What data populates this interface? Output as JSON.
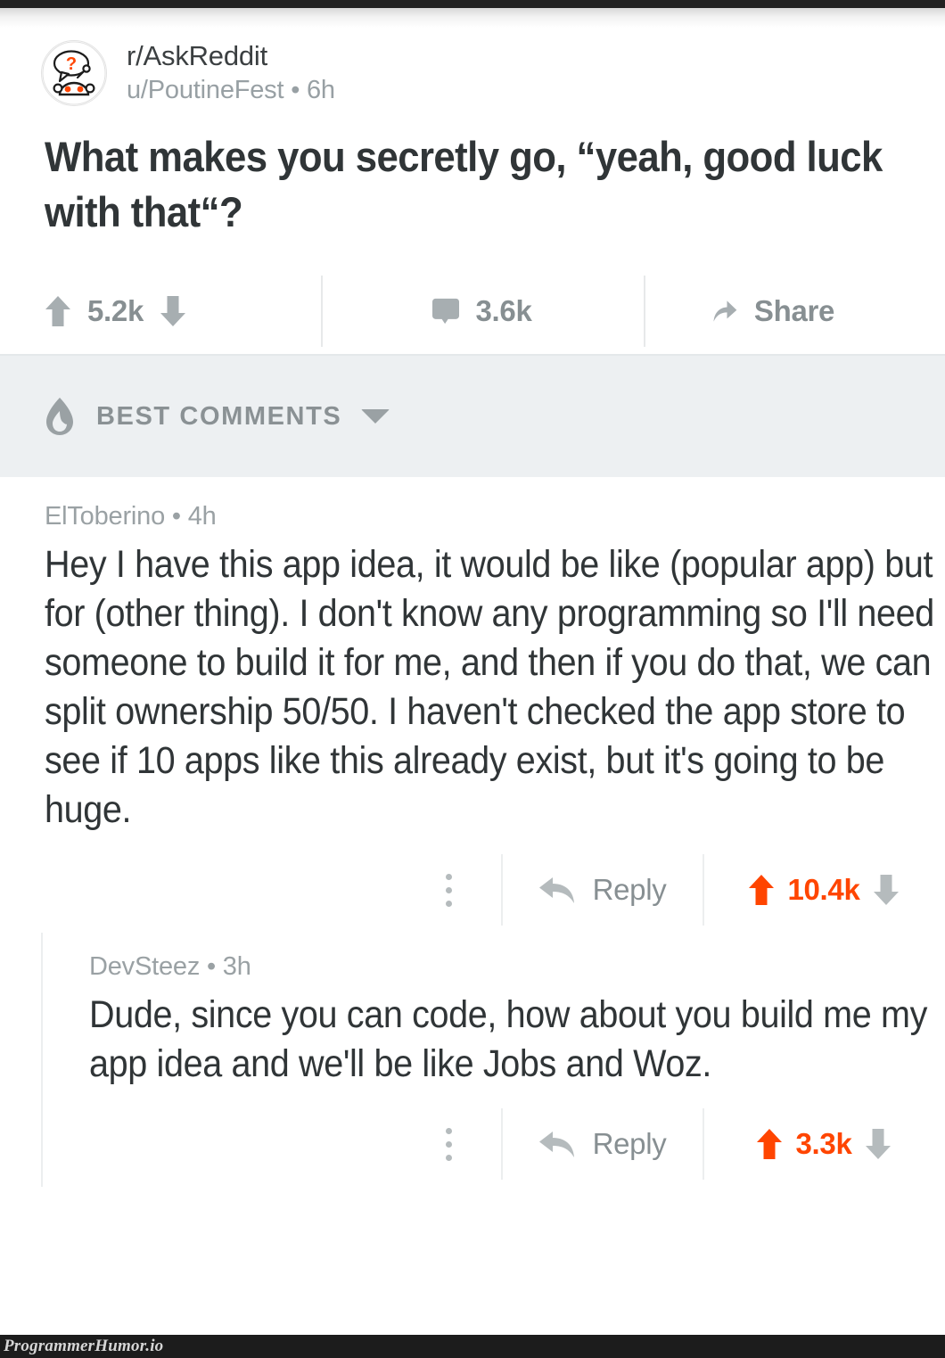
{
  "watermark": {
    "text": "ProgrammerHumor.io"
  },
  "post": {
    "subreddit": "r/AskReddit",
    "meta": "u/PoutineFest • 6h",
    "author": "u/PoutineFest",
    "age": "6h",
    "title": "What makes you secretly go, “yeah, good luck with that“?",
    "avatar_icon": "askreddit-snoo-question-avatar",
    "actions": {
      "upvote_icon": "upvote-arrow-icon",
      "downvote_icon": "downvote-arrow-icon",
      "score": "5.2k",
      "comment_icon": "comment-bubble-icon",
      "comment_count": "3.6k",
      "share_icon": "share-arrow-icon",
      "share_label": "Share"
    }
  },
  "sort_bar": {
    "icon": "flame-icon",
    "label": "BEST COMMENTS",
    "chevron_icon": "chevron-down-icon"
  },
  "comments": [
    {
      "author": "ElToberino",
      "age": "4h",
      "byline": "ElToberino • 4h",
      "body": "Hey I have this app idea, it would be like (popular app) but for (other thing). I don't know any programming so I'll need someone to build it for me, and then if you do that, we can split ownership 50/50. I haven't checked the app store to see if 10 apps like this already exist, but it's going to be huge.",
      "actions": {
        "kebab_icon": "more-options-icon",
        "reply_icon": "reply-arrow-icon",
        "reply_label": "Reply",
        "upvote_icon": "upvote-arrow-icon",
        "downvote_icon": "downvote-arrow-icon",
        "score": "10.4k",
        "score_color": "#ff4500"
      }
    },
    {
      "author": "DevSteez",
      "age": "3h",
      "byline": "DevSteez • 3h",
      "body": "Dude, since you can code, how about you build me my app idea and we'll be like Jobs and Woz.",
      "actions": {
        "kebab_icon": "more-options-icon",
        "reply_icon": "reply-arrow-icon",
        "reply_label": "Reply",
        "upvote_icon": "upvote-arrow-icon",
        "downvote_icon": "downvote-arrow-icon",
        "score": "3.3k",
        "score_color": "#ff4500"
      }
    }
  ],
  "colors": {
    "reddit_orange": "#ff4500",
    "muted_gray": "#878f92",
    "text_dark": "#303537",
    "band_bg": "#edf0f2"
  }
}
